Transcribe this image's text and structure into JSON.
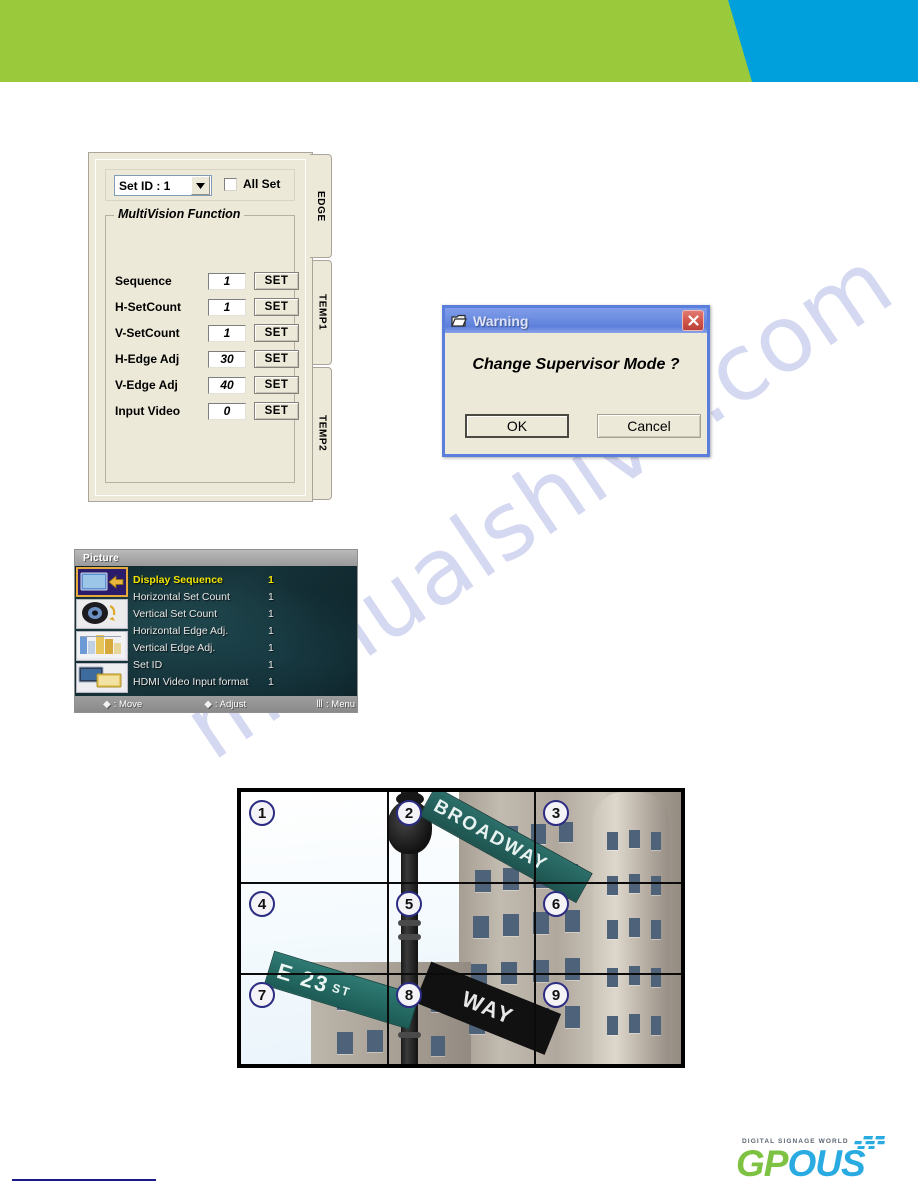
{
  "header": {
    "green_color": "#9ACA3C",
    "blue_color": "#00A0DC"
  },
  "watermark": {
    "text": "manualshive.com"
  },
  "multivision_panel": {
    "setid": {
      "combo_value": "Set ID : 1",
      "combo_icon": "chevron-down-icon",
      "allset_label": "All Set",
      "allset_checked": false
    },
    "group_title": "MultiVision Function",
    "rows": [
      {
        "label": "Sequence",
        "value": "1",
        "button": "SET"
      },
      {
        "label": "H-SetCount",
        "value": "1",
        "button": "SET"
      },
      {
        "label": "V-SetCount",
        "value": "1",
        "button": "SET"
      },
      {
        "label": "H-Edge Adj",
        "value": "30",
        "button": "SET"
      },
      {
        "label": "V-Edge Adj",
        "value": "40",
        "button": "SET"
      },
      {
        "label": "Input Video",
        "value": "0",
        "button": "SET"
      }
    ],
    "tabs": [
      {
        "label": "EDGE",
        "active": true
      },
      {
        "label": "TEMP1",
        "active": false
      },
      {
        "label": "TEMP2",
        "active": false
      }
    ]
  },
  "warning_dialog": {
    "title": "Warning",
    "title_icon": "window-icon",
    "close_icon": "close-icon",
    "message": "Change Supervisor Mode ?",
    "ok_label": "OK",
    "cancel_label": "Cancel"
  },
  "osd_menu": {
    "title": "Picture",
    "icons": [
      {
        "name": "multivision-display-icon",
        "active": true
      },
      {
        "name": "audio-speaker-icon",
        "active": false
      },
      {
        "name": "color-bars-icon",
        "active": false
      },
      {
        "name": "screen-setup-icon",
        "active": false
      }
    ],
    "rows": [
      {
        "label": "Display Sequence",
        "value": "1",
        "selected": true
      },
      {
        "label": "Horizontal Set Count",
        "value": "1",
        "selected": false
      },
      {
        "label": "Vertical Set Count",
        "value": "1",
        "selected": false
      },
      {
        "label": "Horizontal Edge Adj.",
        "value": "1",
        "selected": false
      },
      {
        "label": "Vertical Edge Adj.",
        "value": "1",
        "selected": false
      },
      {
        "label": "Set ID",
        "value": "1",
        "selected": false
      },
      {
        "label": "HDMI Video Input format",
        "value": "1",
        "selected": false
      }
    ],
    "footer": {
      "move_glyph": "up-down-arrow-icon",
      "move_label": ": Move",
      "adjust_glyph": "left-right-arrow-icon",
      "adjust_label": ": Adjust",
      "menu_glyph": "menu-bars-icon",
      "menu_label": ": Menu"
    }
  },
  "video_wall": {
    "tiles": [
      "1",
      "2",
      "3",
      "4",
      "5",
      "6",
      "7",
      "8",
      "9"
    ],
    "photo_signs": {
      "broadway": "BROADWAY",
      "street": "E 23",
      "street_suffix": "ST",
      "oneway": "WAY"
    }
  },
  "footer": {
    "logo": {
      "tagline": "DIGITAL SIGNAGE WORLD",
      "part_g": "GP",
      "part_o": "O",
      "part_us": "US",
      "green": "#7DC242",
      "blue": "#29ABE2"
    }
  }
}
